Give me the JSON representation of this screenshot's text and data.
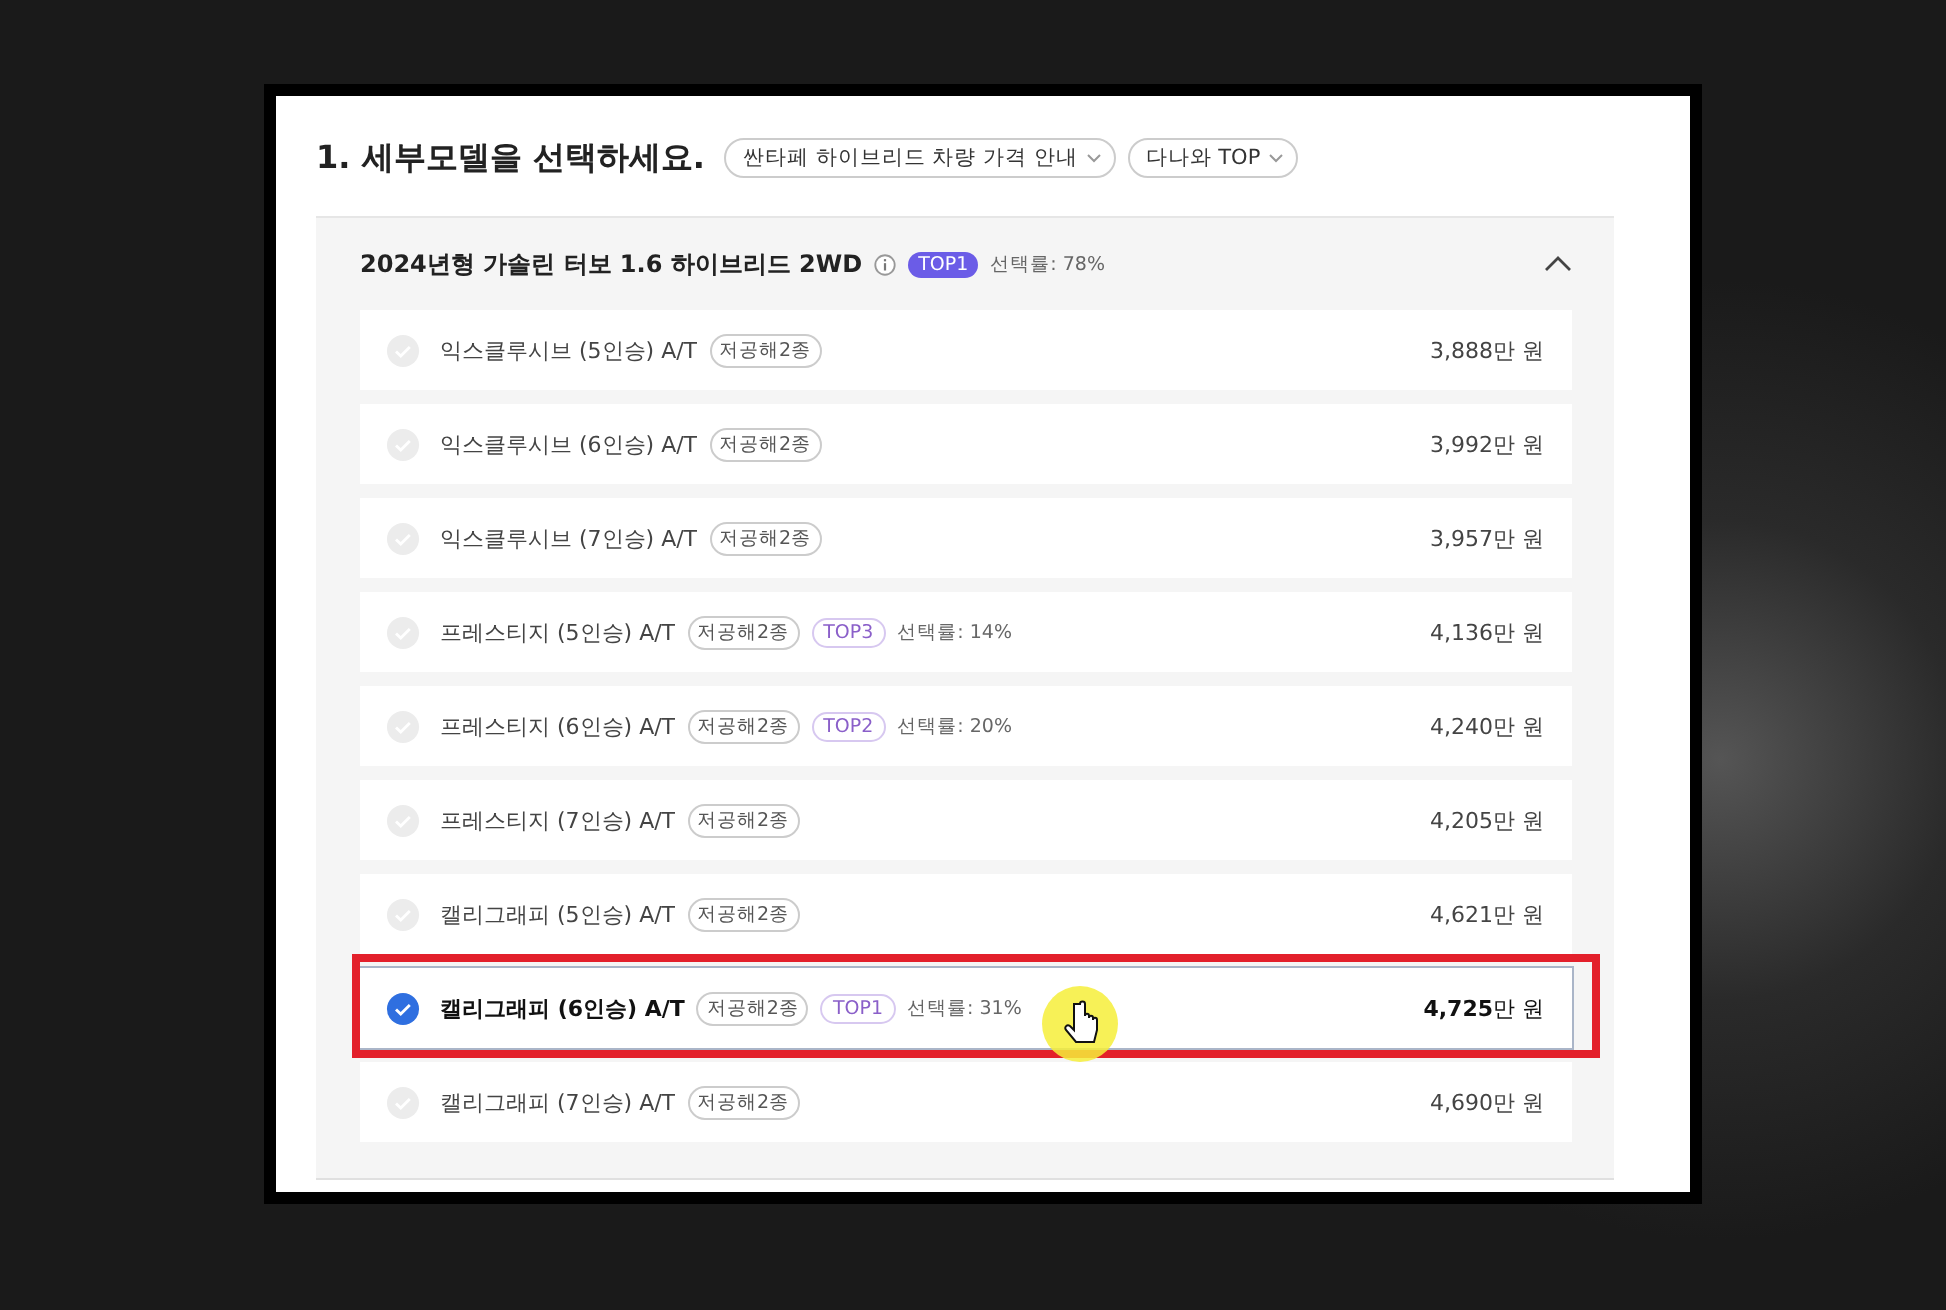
{
  "heading": "1. 세부모델을 선택하세요.",
  "chips": [
    "싼타페 하이브리드 차량 가격 안내",
    "다나와 TOP"
  ],
  "group": {
    "title": "2024년형 가솔린 터보 1.6 하이브리드 2WD",
    "badge": "TOP1",
    "rate": "선택률: 78%",
    "expanded": true
  },
  "rows": [
    {
      "name": "익스클루시브 (5인승) A/T",
      "tag": "저공해2종",
      "price_number": "3,888",
      "price_unit": "만 원",
      "selected": false
    },
    {
      "name": "익스클루시브 (6인승) A/T",
      "tag": "저공해2종",
      "price_number": "3,992",
      "price_unit": "만 원",
      "selected": false
    },
    {
      "name": "익스클루시브 (7인승) A/T",
      "tag": "저공해2종",
      "price_number": "3,957",
      "price_unit": "만 원",
      "selected": false
    },
    {
      "name": "프레스티지 (5인승) A/T",
      "tag": "저공해2종",
      "badge": "TOP3",
      "rate": "선택률: 14%",
      "price_number": "4,136",
      "price_unit": "만 원",
      "selected": false
    },
    {
      "name": "프레스티지 (6인승) A/T",
      "tag": "저공해2종",
      "badge": "TOP2",
      "rate": "선택률: 20%",
      "price_number": "4,240",
      "price_unit": "만 원",
      "selected": false
    },
    {
      "name": "프레스티지 (7인승) A/T",
      "tag": "저공해2종",
      "price_number": "4,205",
      "price_unit": "만 원",
      "selected": false
    },
    {
      "name": "캘리그래피 (5인승) A/T",
      "tag": "저공해2종",
      "price_number": "4,621",
      "price_unit": "만 원",
      "selected": false
    },
    {
      "name": "캘리그래피 (6인승) A/T",
      "tag": "저공해2종",
      "badge": "TOP1",
      "rate": "선택률: 31%",
      "price_number": "4,725",
      "price_unit": "만 원",
      "selected": true
    },
    {
      "name": "캘리그래피 (7인승) A/T",
      "tag": "저공해2종",
      "price_number": "4,690",
      "price_unit": "만 원",
      "selected": false
    }
  ]
}
